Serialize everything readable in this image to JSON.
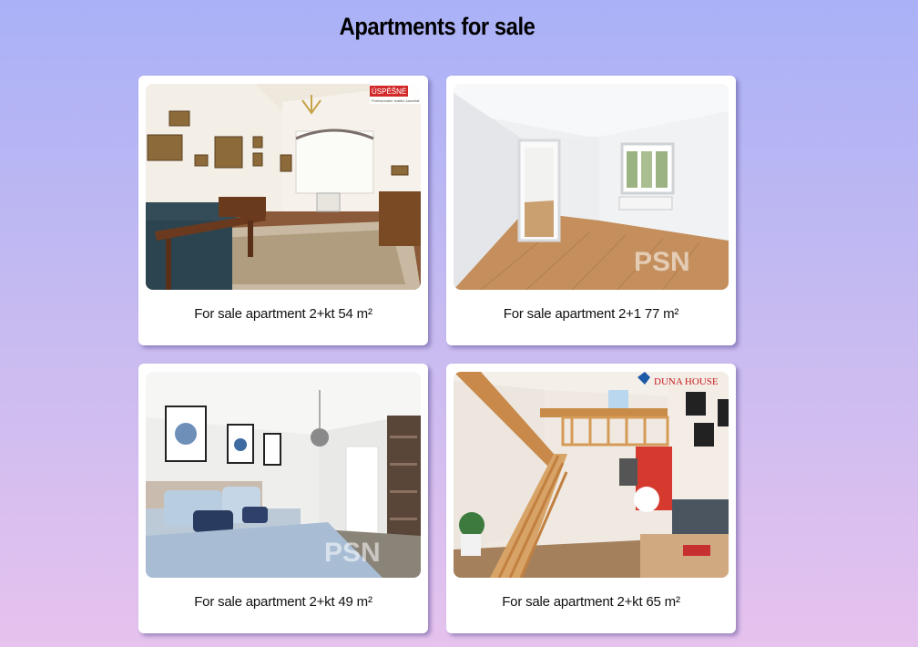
{
  "page": {
    "title": "Apartments for sale"
  },
  "listings": [
    {
      "caption": "For sale apartment 2+kt 54 m²",
      "photo": "living-room-with-carpet-photo",
      "watermark": "ÚSPĚŠNÉ REALITY",
      "watermark_sub": "Profesionální realitní kancelář"
    },
    {
      "caption": "For sale apartment 2+1 77 m²",
      "photo": "empty-room-parquet-photo",
      "watermark": "PSN"
    },
    {
      "caption": "For sale apartment 2+kt 49 m²",
      "photo": "bedroom-photo",
      "watermark": "PSN"
    },
    {
      "caption": "For sale apartment 2+kt 65 m²",
      "photo": "loft-with-staircase-photo",
      "watermark": "DUNA HOUSE"
    }
  ],
  "colors": {
    "accent_red": "#d22a2a",
    "card_bg": "#ffffff",
    "text": "#111111"
  }
}
